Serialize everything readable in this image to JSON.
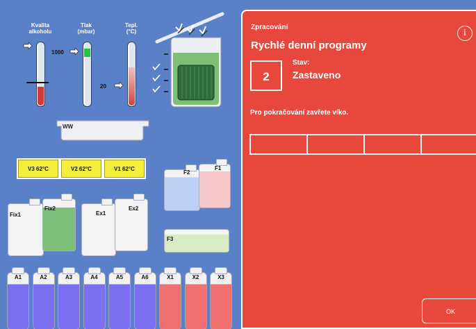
{
  "gauges": {
    "alcohol": {
      "header": "Kvalita\nalkoholu",
      "level": 0.3
    },
    "pressure": {
      "header": "Tlak\n(mbar)",
      "top_value": "1000",
      "bottom_value": "20"
    },
    "temperature": {
      "header": "Tepl.\n(°C)"
    }
  },
  "wax_bath": {
    "label": "WW"
  },
  "ovens": [
    {
      "label": "V3  62°C"
    },
    {
      "label": "V2  62°C"
    },
    {
      "label": "V1  62°C"
    }
  ],
  "containers": {
    "fix1": "Fix1",
    "fix2": "Fix2",
    "ex1": "Ex1",
    "ex2": "Ex2",
    "f1": "F1",
    "f2": "F2",
    "f3": "F3"
  },
  "bottles": [
    {
      "label": "A1",
      "color": "#7b6ff0"
    },
    {
      "label": "A2",
      "color": "#7b6ff0"
    },
    {
      "label": "A3",
      "color": "#7b6ff0"
    },
    {
      "label": "A4",
      "color": "#7b6ff0"
    },
    {
      "label": "A5",
      "color": "#7b6ff0"
    },
    {
      "label": "A6",
      "color": "#7b6ff0"
    },
    {
      "label": "X1",
      "color": "#f07070"
    },
    {
      "label": "X2",
      "color": "#f07070"
    },
    {
      "label": "X3",
      "color": "#f07070"
    }
  ],
  "panel": {
    "category": "Zpracování",
    "title": "Rychlé denní programy",
    "info_icon": "i",
    "step_number": "2",
    "status_label": "Stav:",
    "status_value": "Zastaveno",
    "message": "Pro pokračování zavřete víko.",
    "ok_label": "OK"
  },
  "colors": {
    "background": "#5a80c8",
    "panel": "#e8473b",
    "oven_yellow": "#f2ee3a",
    "green_fill": "#7dbf78",
    "pressure_green": "#1fc83a"
  }
}
